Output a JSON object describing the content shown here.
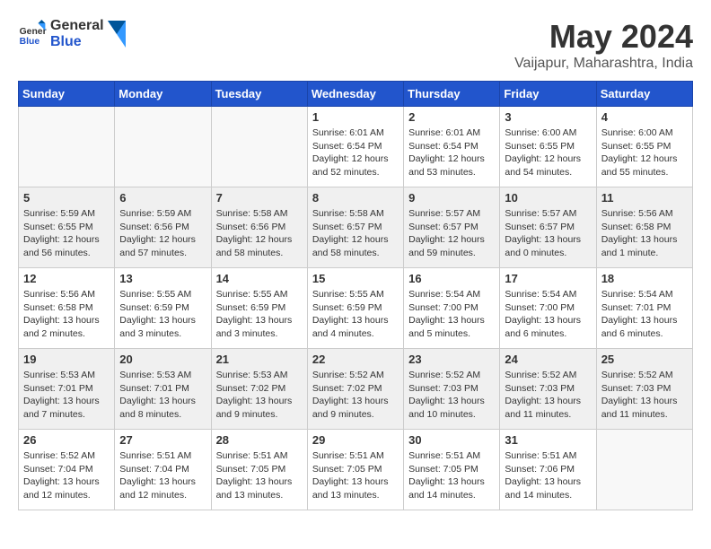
{
  "header": {
    "logo_general": "General",
    "logo_blue": "Blue",
    "month_year": "May 2024",
    "location": "Vaijapur, Maharashtra, India"
  },
  "days_of_week": [
    "Sunday",
    "Monday",
    "Tuesday",
    "Wednesday",
    "Thursday",
    "Friday",
    "Saturday"
  ],
  "weeks": [
    [
      {
        "day": "",
        "empty": true
      },
      {
        "day": "",
        "empty": true
      },
      {
        "day": "",
        "empty": true
      },
      {
        "day": "1",
        "sunrise": "6:01 AM",
        "sunset": "6:54 PM",
        "daylight": "12 hours and 52 minutes."
      },
      {
        "day": "2",
        "sunrise": "6:01 AM",
        "sunset": "6:54 PM",
        "daylight": "12 hours and 53 minutes."
      },
      {
        "day": "3",
        "sunrise": "6:00 AM",
        "sunset": "6:55 PM",
        "daylight": "12 hours and 54 minutes."
      },
      {
        "day": "4",
        "sunrise": "6:00 AM",
        "sunset": "6:55 PM",
        "daylight": "12 hours and 55 minutes."
      }
    ],
    [
      {
        "day": "5",
        "sunrise": "5:59 AM",
        "sunset": "6:55 PM",
        "daylight": "12 hours and 56 minutes."
      },
      {
        "day": "6",
        "sunrise": "5:59 AM",
        "sunset": "6:56 PM",
        "daylight": "12 hours and 57 minutes."
      },
      {
        "day": "7",
        "sunrise": "5:58 AM",
        "sunset": "6:56 PM",
        "daylight": "12 hours and 58 minutes."
      },
      {
        "day": "8",
        "sunrise": "5:58 AM",
        "sunset": "6:57 PM",
        "daylight": "12 hours and 58 minutes."
      },
      {
        "day": "9",
        "sunrise": "5:57 AM",
        "sunset": "6:57 PM",
        "daylight": "12 hours and 59 minutes."
      },
      {
        "day": "10",
        "sunrise": "5:57 AM",
        "sunset": "6:57 PM",
        "daylight": "13 hours and 0 minutes."
      },
      {
        "day": "11",
        "sunrise": "5:56 AM",
        "sunset": "6:58 PM",
        "daylight": "13 hours and 1 minute."
      }
    ],
    [
      {
        "day": "12",
        "sunrise": "5:56 AM",
        "sunset": "6:58 PM",
        "daylight": "13 hours and 2 minutes."
      },
      {
        "day": "13",
        "sunrise": "5:55 AM",
        "sunset": "6:59 PM",
        "daylight": "13 hours and 3 minutes."
      },
      {
        "day": "14",
        "sunrise": "5:55 AM",
        "sunset": "6:59 PM",
        "daylight": "13 hours and 3 minutes."
      },
      {
        "day": "15",
        "sunrise": "5:55 AM",
        "sunset": "6:59 PM",
        "daylight": "13 hours and 4 minutes."
      },
      {
        "day": "16",
        "sunrise": "5:54 AM",
        "sunset": "7:00 PM",
        "daylight": "13 hours and 5 minutes."
      },
      {
        "day": "17",
        "sunrise": "5:54 AM",
        "sunset": "7:00 PM",
        "daylight": "13 hours and 6 minutes."
      },
      {
        "day": "18",
        "sunrise": "5:54 AM",
        "sunset": "7:01 PM",
        "daylight": "13 hours and 6 minutes."
      }
    ],
    [
      {
        "day": "19",
        "sunrise": "5:53 AM",
        "sunset": "7:01 PM",
        "daylight": "13 hours and 7 minutes."
      },
      {
        "day": "20",
        "sunrise": "5:53 AM",
        "sunset": "7:01 PM",
        "daylight": "13 hours and 8 minutes."
      },
      {
        "day": "21",
        "sunrise": "5:53 AM",
        "sunset": "7:02 PM",
        "daylight": "13 hours and 9 minutes."
      },
      {
        "day": "22",
        "sunrise": "5:52 AM",
        "sunset": "7:02 PM",
        "daylight": "13 hours and 9 minutes."
      },
      {
        "day": "23",
        "sunrise": "5:52 AM",
        "sunset": "7:03 PM",
        "daylight": "13 hours and 10 minutes."
      },
      {
        "day": "24",
        "sunrise": "5:52 AM",
        "sunset": "7:03 PM",
        "daylight": "13 hours and 11 minutes."
      },
      {
        "day": "25",
        "sunrise": "5:52 AM",
        "sunset": "7:03 PM",
        "daylight": "13 hours and 11 minutes."
      }
    ],
    [
      {
        "day": "26",
        "sunrise": "5:52 AM",
        "sunset": "7:04 PM",
        "daylight": "13 hours and 12 minutes."
      },
      {
        "day": "27",
        "sunrise": "5:51 AM",
        "sunset": "7:04 PM",
        "daylight": "13 hours and 12 minutes."
      },
      {
        "day": "28",
        "sunrise": "5:51 AM",
        "sunset": "7:05 PM",
        "daylight": "13 hours and 13 minutes."
      },
      {
        "day": "29",
        "sunrise": "5:51 AM",
        "sunset": "7:05 PM",
        "daylight": "13 hours and 13 minutes."
      },
      {
        "day": "30",
        "sunrise": "5:51 AM",
        "sunset": "7:05 PM",
        "daylight": "13 hours and 14 minutes."
      },
      {
        "day": "31",
        "sunrise": "5:51 AM",
        "sunset": "7:06 PM",
        "daylight": "13 hours and 14 minutes."
      },
      {
        "day": "",
        "empty": true
      }
    ]
  ]
}
